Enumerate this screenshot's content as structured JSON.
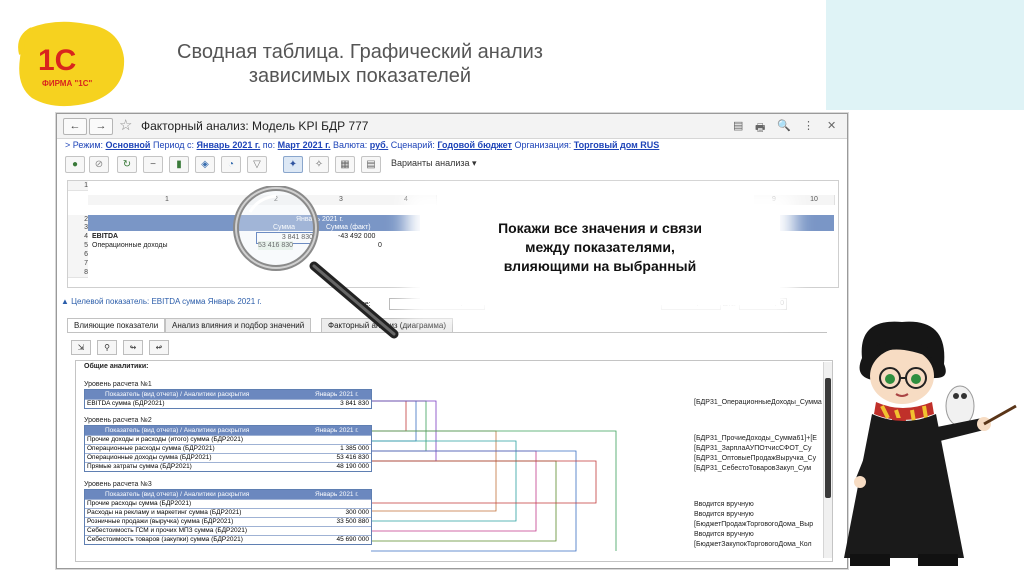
{
  "logo": {
    "brand": "1С",
    "firm": "ФИРМА \"1С\""
  },
  "slide": {
    "title": "Сводная таблица. Графический анализ зависимых показателей"
  },
  "window": {
    "title": "Факторный анализ: Модель KPI БДР 777",
    "nav_back": "←",
    "nav_forward": "→",
    "controls": [
      "▤",
      "🖶",
      "🔍",
      "⋮",
      "✕"
    ]
  },
  "params": {
    "prefix": "> Режим: ",
    "mode": "Основной",
    "period_label": " Период с: ",
    "period_from": "Январь 2021 г.",
    "period_to_label": " по: ",
    "period_to": "Март 2021 г.",
    "currency_label": " Валюта: ",
    "currency": "руб.",
    "scenario_label": " Сценарий: ",
    "scenario": "Годовой бюджет",
    "org_label": " Организация: ",
    "org": "Торговый дом RUS"
  },
  "toolbar": {
    "variants_label": "Варианты анализа"
  },
  "grid": {
    "col_numbers": [
      "1",
      "2",
      "3",
      "4",
      "9",
      "10"
    ],
    "row_numbers": [
      "1",
      "2",
      "3",
      "4",
      "5",
      "6",
      "7",
      "8"
    ],
    "header_month": "Январь 2021 г.",
    "header_sum": "Сумма",
    "header_sum_fact": "Сумма (факт)",
    "row4_label": "EBITDA",
    "row4_value": "3 841 830",
    "row4_fact": "-43 492 000",
    "row5_label": "Операционные доходы",
    "row5_value": "53 416 830",
    "row5_fact": "0"
  },
  "target": {
    "label": "Целевой показатель: EBITDA сумма Январь 2021 г.",
    "value_label": "ние:",
    "value": "3 841 830,00000",
    "delta_label": "ΔЗ:",
    "delta_value": "0,00000",
    "delta_pct_label": "Δ%:",
    "delta_pct": "0,00"
  },
  "tabs": [
    {
      "label": "Влияющие показатели"
    },
    {
      "label": "Анализ влияния и подбор значений"
    },
    {
      "label": "Факторный анализ (диаграмма)"
    }
  ],
  "analysis": {
    "general_label": "Общие аналитики:",
    "col_indicator": "Показатель (вид отчета) / Аналитики раскрытия",
    "col_month": "Январь 2021 г.",
    "level1": {
      "title": "Уровень расчета №1",
      "rows": [
        {
          "name": "EBITDA сумма (БДР2021)",
          "value": "3 841 830"
        }
      ]
    },
    "level2": {
      "title": "Уровень расчета №2",
      "rows": [
        {
          "name": "Прочие доходы и расходы (итого) сумма (БДР2021)",
          "value": ""
        },
        {
          "name": "Операционные расходы сумма (БДР2021)",
          "value": "1 385 000"
        },
        {
          "name": "Операционные доходы сумма (БДР2021)",
          "value": "53 416 830"
        },
        {
          "name": "Прямые затраты сумма (БДР2021)",
          "value": "48 190 000"
        }
      ]
    },
    "level3": {
      "title": "Уровень расчета №3",
      "rows": [
        {
          "name": "Прочие расходы сумма (БДР2021)",
          "value": ""
        },
        {
          "name": "Расходы на рекламу и маркетинг сумма (БДР2021)",
          "value": "300 000"
        },
        {
          "name": "Розничные продажи (выручка) сумма (БДР2021)",
          "value": "33 500 880"
        },
        {
          "name": "Себестоимость ГСМ и прочих МПЗ сумма (БДР2021)",
          "value": ""
        },
        {
          "name": "Себестоимость товаров (закупки) сумма (БДР2021)",
          "value": "45 690 000"
        }
      ]
    },
    "right_labels": [
      "[БДР31_ОперационныеДоходы_Сумма",
      "[БДР31_ПрочиеДоходы_Сумма61]+[Е",
      "[БДР31_ЗарплаАУПОтчисСФОТ_Су",
      "[БДР31_ОптовыеПродажВыручка_Су",
      "[БДР31_СебестоТоваровЗакуп_Сум",
      "Вводится вручную",
      "Вводится вручную",
      "[БюджетПродажТорговогоДома_Выр",
      "Вводится вручную",
      "[БюджетЗакупокТорговогоДома_Кол"
    ]
  },
  "callout": {
    "line1": "Покажи все значения и связи",
    "line2": "между показателями,",
    "line3": "влияющими на выбранный"
  }
}
